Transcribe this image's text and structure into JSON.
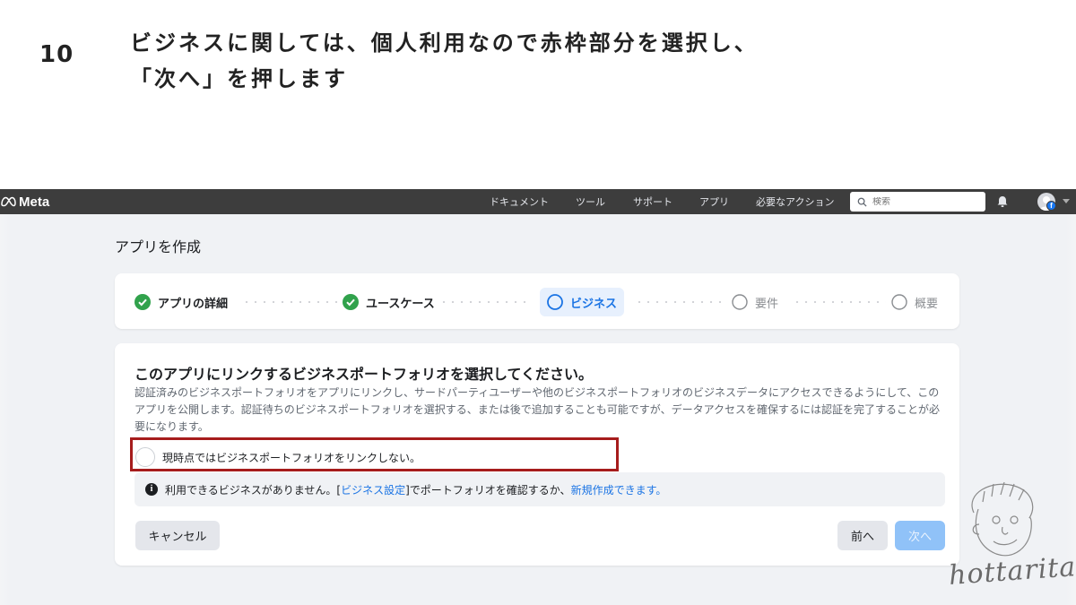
{
  "slide": {
    "step_number": "10",
    "instruction_line1": "ビジネスに関しては、個人利用なので赤枠部分を選択し、",
    "instruction_line2": "「次へ」を押します"
  },
  "topbar": {
    "brand": "Meta",
    "nav": [
      "ドキュメント",
      "ツール",
      "サポート",
      "アプリ",
      "必要なアクション"
    ],
    "search_placeholder": "検索",
    "badge_letter": "f"
  },
  "page": {
    "title": "アプリを作成"
  },
  "stepper": {
    "steps": [
      {
        "label": "アプリの詳細",
        "state": "done"
      },
      {
        "label": "ユースケース",
        "state": "done"
      },
      {
        "label": "ビジネス",
        "state": "current"
      },
      {
        "label": "要件",
        "state": "todo"
      },
      {
        "label": "概要",
        "state": "todo"
      }
    ]
  },
  "card": {
    "title": "このアプリにリンクするビジネスポートフォリオを選択してください。",
    "description": "認証済みのビジネスポートフォリオをアプリにリンクし、サードパーティユーザーや他のビジネスポートフォリオのビジネスデータにアクセスできるようにして、このアプリを公開します。認証待ちのビジネスポートフォリオを選択する、または後で追加することも可能ですが、データアクセスを確保するには認証を完了することが必要になります。",
    "radio_option": "現時点ではビジネスポートフォリオをリンクしない。",
    "info": {
      "icon": "i",
      "text_before": "利用できるビジネスがありません。[",
      "link1": "ビジネス設定",
      "text_middle": "]でポートフォリオを確認するか、",
      "link2": "新規作成できます。"
    }
  },
  "buttons": {
    "cancel": "キャンセル",
    "prev": "前へ",
    "next": "次へ"
  },
  "watermark": {
    "text": "hottarita"
  },
  "colors": {
    "topbar": "#3d3d3d",
    "accent": "#1b74e4",
    "done_check": "#31a24c",
    "highlight_frame": "#a61c1c",
    "next_disabled": "#90c2f8"
  },
  "icons": {
    "topbar": [
      "meta-logo-icon",
      "search-icon",
      "bell-icon",
      "avatar-icon",
      "facebook-badge-icon",
      "chevron-down-icon"
    ],
    "stepper": [
      "check-circle-icon",
      "empty-circle-icon"
    ],
    "info": "info-icon"
  }
}
